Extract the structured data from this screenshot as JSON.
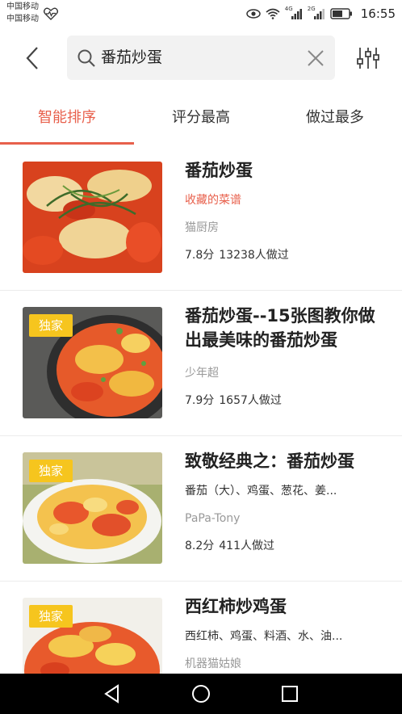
{
  "status_bar": {
    "carrier1": "中国移动",
    "carrier2": "中国移动",
    "net1": "4G",
    "net2": "2G",
    "time": "16:55"
  },
  "search": {
    "query": "番茄炒蛋"
  },
  "tabs": [
    {
      "label": "智能排序",
      "active": true
    },
    {
      "label": "评分最高",
      "active": false
    },
    {
      "label": "做过最多",
      "active": false
    }
  ],
  "recipes": [
    {
      "title": "番茄炒蛋",
      "subtitle": "收藏的菜谱",
      "author": "猫厨房",
      "rating": "7.8分",
      "made": "13238人做过",
      "badge": ""
    },
    {
      "title": "番茄炒蛋--15张图教你做出最美味的番茄炒蛋",
      "subtitle": "",
      "author": "少年超",
      "rating": "7.9分",
      "made": "1657人做过",
      "badge": "独家"
    },
    {
      "title": "致敬经典之：番茄炒蛋",
      "subtitle": "番茄（大）、鸡蛋、葱花、姜...",
      "author": "PaPa-Tony",
      "rating": "8.2分",
      "made": "411人做过",
      "badge": "独家"
    },
    {
      "title": "西红柿炒鸡蛋",
      "subtitle": "西红柿、鸡蛋、料酒、水、油...",
      "author": "机器猫姑娘",
      "rating": "",
      "made": "",
      "badge": "独家"
    }
  ],
  "colors": {
    "accent": "#e8604c",
    "badge": "#f6c51e"
  }
}
